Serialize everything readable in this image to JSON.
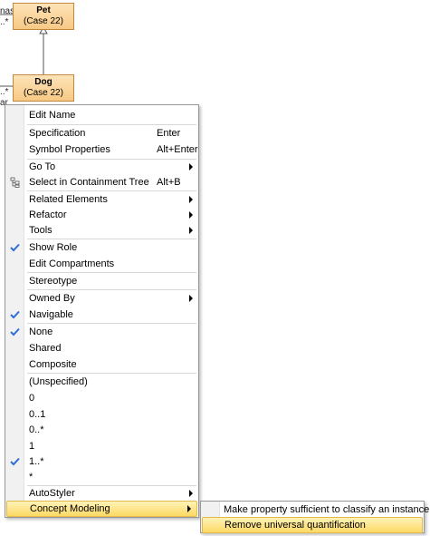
{
  "diagram": {
    "classes": [
      {
        "name": "Pet",
        "stereotype": "(Case 22)"
      },
      {
        "name": "Dog",
        "stereotype": "(Case 22)"
      }
    ],
    "edge_labels": {
      "top_role": "nas",
      "top_mult": "..*",
      "bottom_mult": "..*",
      "bottom_role": "ar"
    }
  },
  "menu": {
    "items": [
      {
        "label": "Edit Name"
      },
      {
        "label": "Specification",
        "shortcut": "Enter"
      },
      {
        "label": "Symbol Properties",
        "shortcut": "Alt+Enter"
      },
      {
        "label": "Go To",
        "submenu": true
      },
      {
        "label": "Select in Containment Tree",
        "shortcut": "Alt+B",
        "icon": "containment-tree-icon"
      },
      {
        "label": "Related Elements",
        "submenu": true
      },
      {
        "label": "Refactor",
        "submenu": true
      },
      {
        "label": "Tools",
        "submenu": true
      },
      {
        "label": "Show Role",
        "checked": true
      },
      {
        "label": "Edit Compartments"
      },
      {
        "label": "Stereotype"
      },
      {
        "label": "Owned By",
        "submenu": true
      },
      {
        "label": "Navigable",
        "checked": true
      },
      {
        "label": "None",
        "checked": true
      },
      {
        "label": "Shared"
      },
      {
        "label": "Composite"
      },
      {
        "label": "(Unspecified)"
      },
      {
        "label": "0"
      },
      {
        "label": "0..1"
      },
      {
        "label": "0..*"
      },
      {
        "label": "1"
      },
      {
        "label": "1..*",
        "checked": true
      },
      {
        "label": "*"
      },
      {
        "label": "AutoStyler",
        "submenu": true
      },
      {
        "label": "Concept Modeling",
        "submenu": true,
        "highlighted": true
      }
    ]
  },
  "submenu": {
    "items": [
      {
        "label": "Make property sufficient to classify an instance"
      },
      {
        "label": "Remove universal quantification",
        "highlighted": true
      }
    ]
  },
  "colors": {
    "class_fill_top": "#fde3b8",
    "class_fill_bottom": "#f7c985",
    "class_border": "#c08a3e",
    "highlight_top": "#fff3b8",
    "highlight_bottom": "#fcd964",
    "check_blue": "#2f6fd6",
    "check_bg_yellow": "#fce89a"
  }
}
